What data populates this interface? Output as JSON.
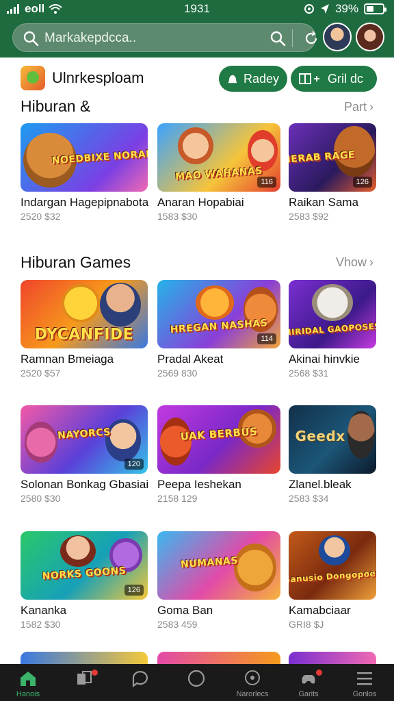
{
  "status_bar": {
    "signal": "ıl",
    "carrier": "eoll",
    "time": "1931",
    "battery_text": "39%"
  },
  "search": {
    "placeholder": "Markakepdcca.."
  },
  "header": {
    "app_title": "Ulnrkesploam",
    "button_ready": "Radey",
    "button_grid": "Gril dc"
  },
  "sections": [
    {
      "title": "Hiburan &",
      "more": "Part",
      "items": [
        {
          "name": "Indargan Hagepipnabota",
          "meta": "2520  $32",
          "banner": "NOEDBIXE NORAB",
          "badge": ""
        },
        {
          "name": "Anaran Hopabiai",
          "meta": "1583  $30",
          "banner": "MAO WAHANAS",
          "badge": "116"
        },
        {
          "name": "Raikan Sama",
          "meta": "2583  $92",
          "banner": "NERAB RAGE",
          "badge": "126"
        }
      ]
    },
    {
      "title": "Hiburan Games",
      "more": "Vhow",
      "items": [
        {
          "name": "Ramnan Bmeiaga",
          "meta": "2520  $57",
          "banner": "DYCANFIDE",
          "badge": ""
        },
        {
          "name": "Pradal Akeat",
          "meta": "2569  830",
          "banner": "HREGAN NASHAS",
          "badge": "114"
        },
        {
          "name": "Akinai hinvkie",
          "meta": "2568  $31",
          "banner": "HIRIDAL GAOPOSES",
          "badge": ""
        }
      ]
    },
    {
      "title": "",
      "more": "",
      "items": [
        {
          "name": "Solonan Bonkag Gbasiai",
          "meta": "2580  $30",
          "banner": "NAYORCS",
          "badge": "120"
        },
        {
          "name": "Peepa Ieshekan",
          "meta": "2158  129",
          "banner": "UAK BERBUS",
          "badge": ""
        },
        {
          "name": "Zlanel.bleak",
          "meta": "2583  $34",
          "banner": "Geedx",
          "badge": ""
        }
      ]
    },
    {
      "title": "",
      "more": "",
      "items": [
        {
          "name": "Kananka",
          "meta": "1582  $30",
          "banner": "NORKS GOONS",
          "badge": "126"
        },
        {
          "name": "Goma Ban",
          "meta": "2583  459",
          "banner": "NUMANAS",
          "badge": ""
        },
        {
          "name": "Kamabciaar",
          "meta": "GRI8  $J",
          "banner": "Sanusio Dongopoes",
          "badge": ""
        }
      ]
    }
  ],
  "bottom_nav": [
    {
      "label": "Hanois",
      "icon": "home-icon",
      "active": true
    },
    {
      "label": "",
      "icon": "cards-icon",
      "active": false
    },
    {
      "label": "",
      "icon": "chat-icon",
      "active": false
    },
    {
      "label": "",
      "icon": "circle-icon",
      "active": false
    },
    {
      "label": "Narorlecs",
      "icon": "message-icon",
      "active": false
    },
    {
      "label": "Garits",
      "icon": "gamepad-icon",
      "active": false
    },
    {
      "label": "Gonlos",
      "icon": "menu-icon",
      "active": false
    }
  ],
  "colors": {
    "header_green": "#1d6b3f",
    "pill_green": "#1f7a45",
    "nav_bg": "#1a1a1a",
    "active_green": "#3bb36a"
  }
}
